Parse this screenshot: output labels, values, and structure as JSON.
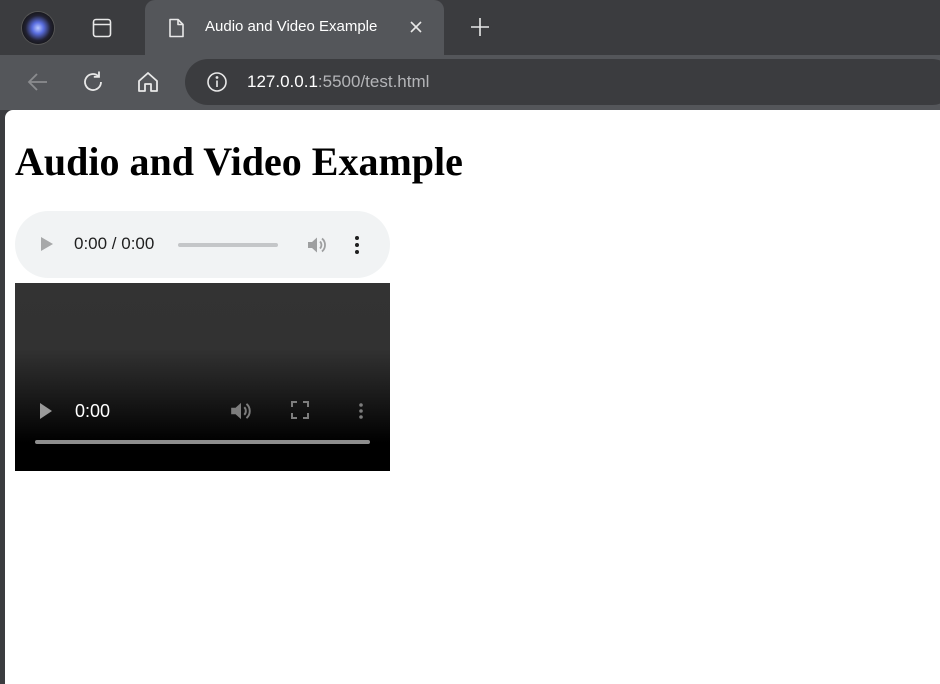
{
  "browser": {
    "tab": {
      "title": "Audio and Video Example"
    },
    "toolbar": {
      "url_host": "127.0.0.1",
      "url_rest": ":5500/test.html"
    }
  },
  "page": {
    "heading": "Audio and Video Example",
    "audio": {
      "time": "0:00 / 0:00",
      "progress": 0
    },
    "video": {
      "time": "0:00",
      "progress": 0
    }
  },
  "icons": {
    "profile": "profile-avatar-icon",
    "tab_actions": "tab-actions-icon",
    "favicon": "page-document-icon",
    "close": "close-icon",
    "new_tab": "plus-icon",
    "back": "arrow-left-icon",
    "reload": "reload-icon",
    "home": "home-icon",
    "info": "info-icon",
    "play": "play-icon",
    "volume": "volume-icon",
    "fullscreen": "fullscreen-icon",
    "menu": "more-vert-icon"
  },
  "colors": {
    "tab_strip": "#3b3c3f",
    "toolbar": "#54565a",
    "audio_bg": "#f1f3f4",
    "video_bg": "#000000"
  }
}
